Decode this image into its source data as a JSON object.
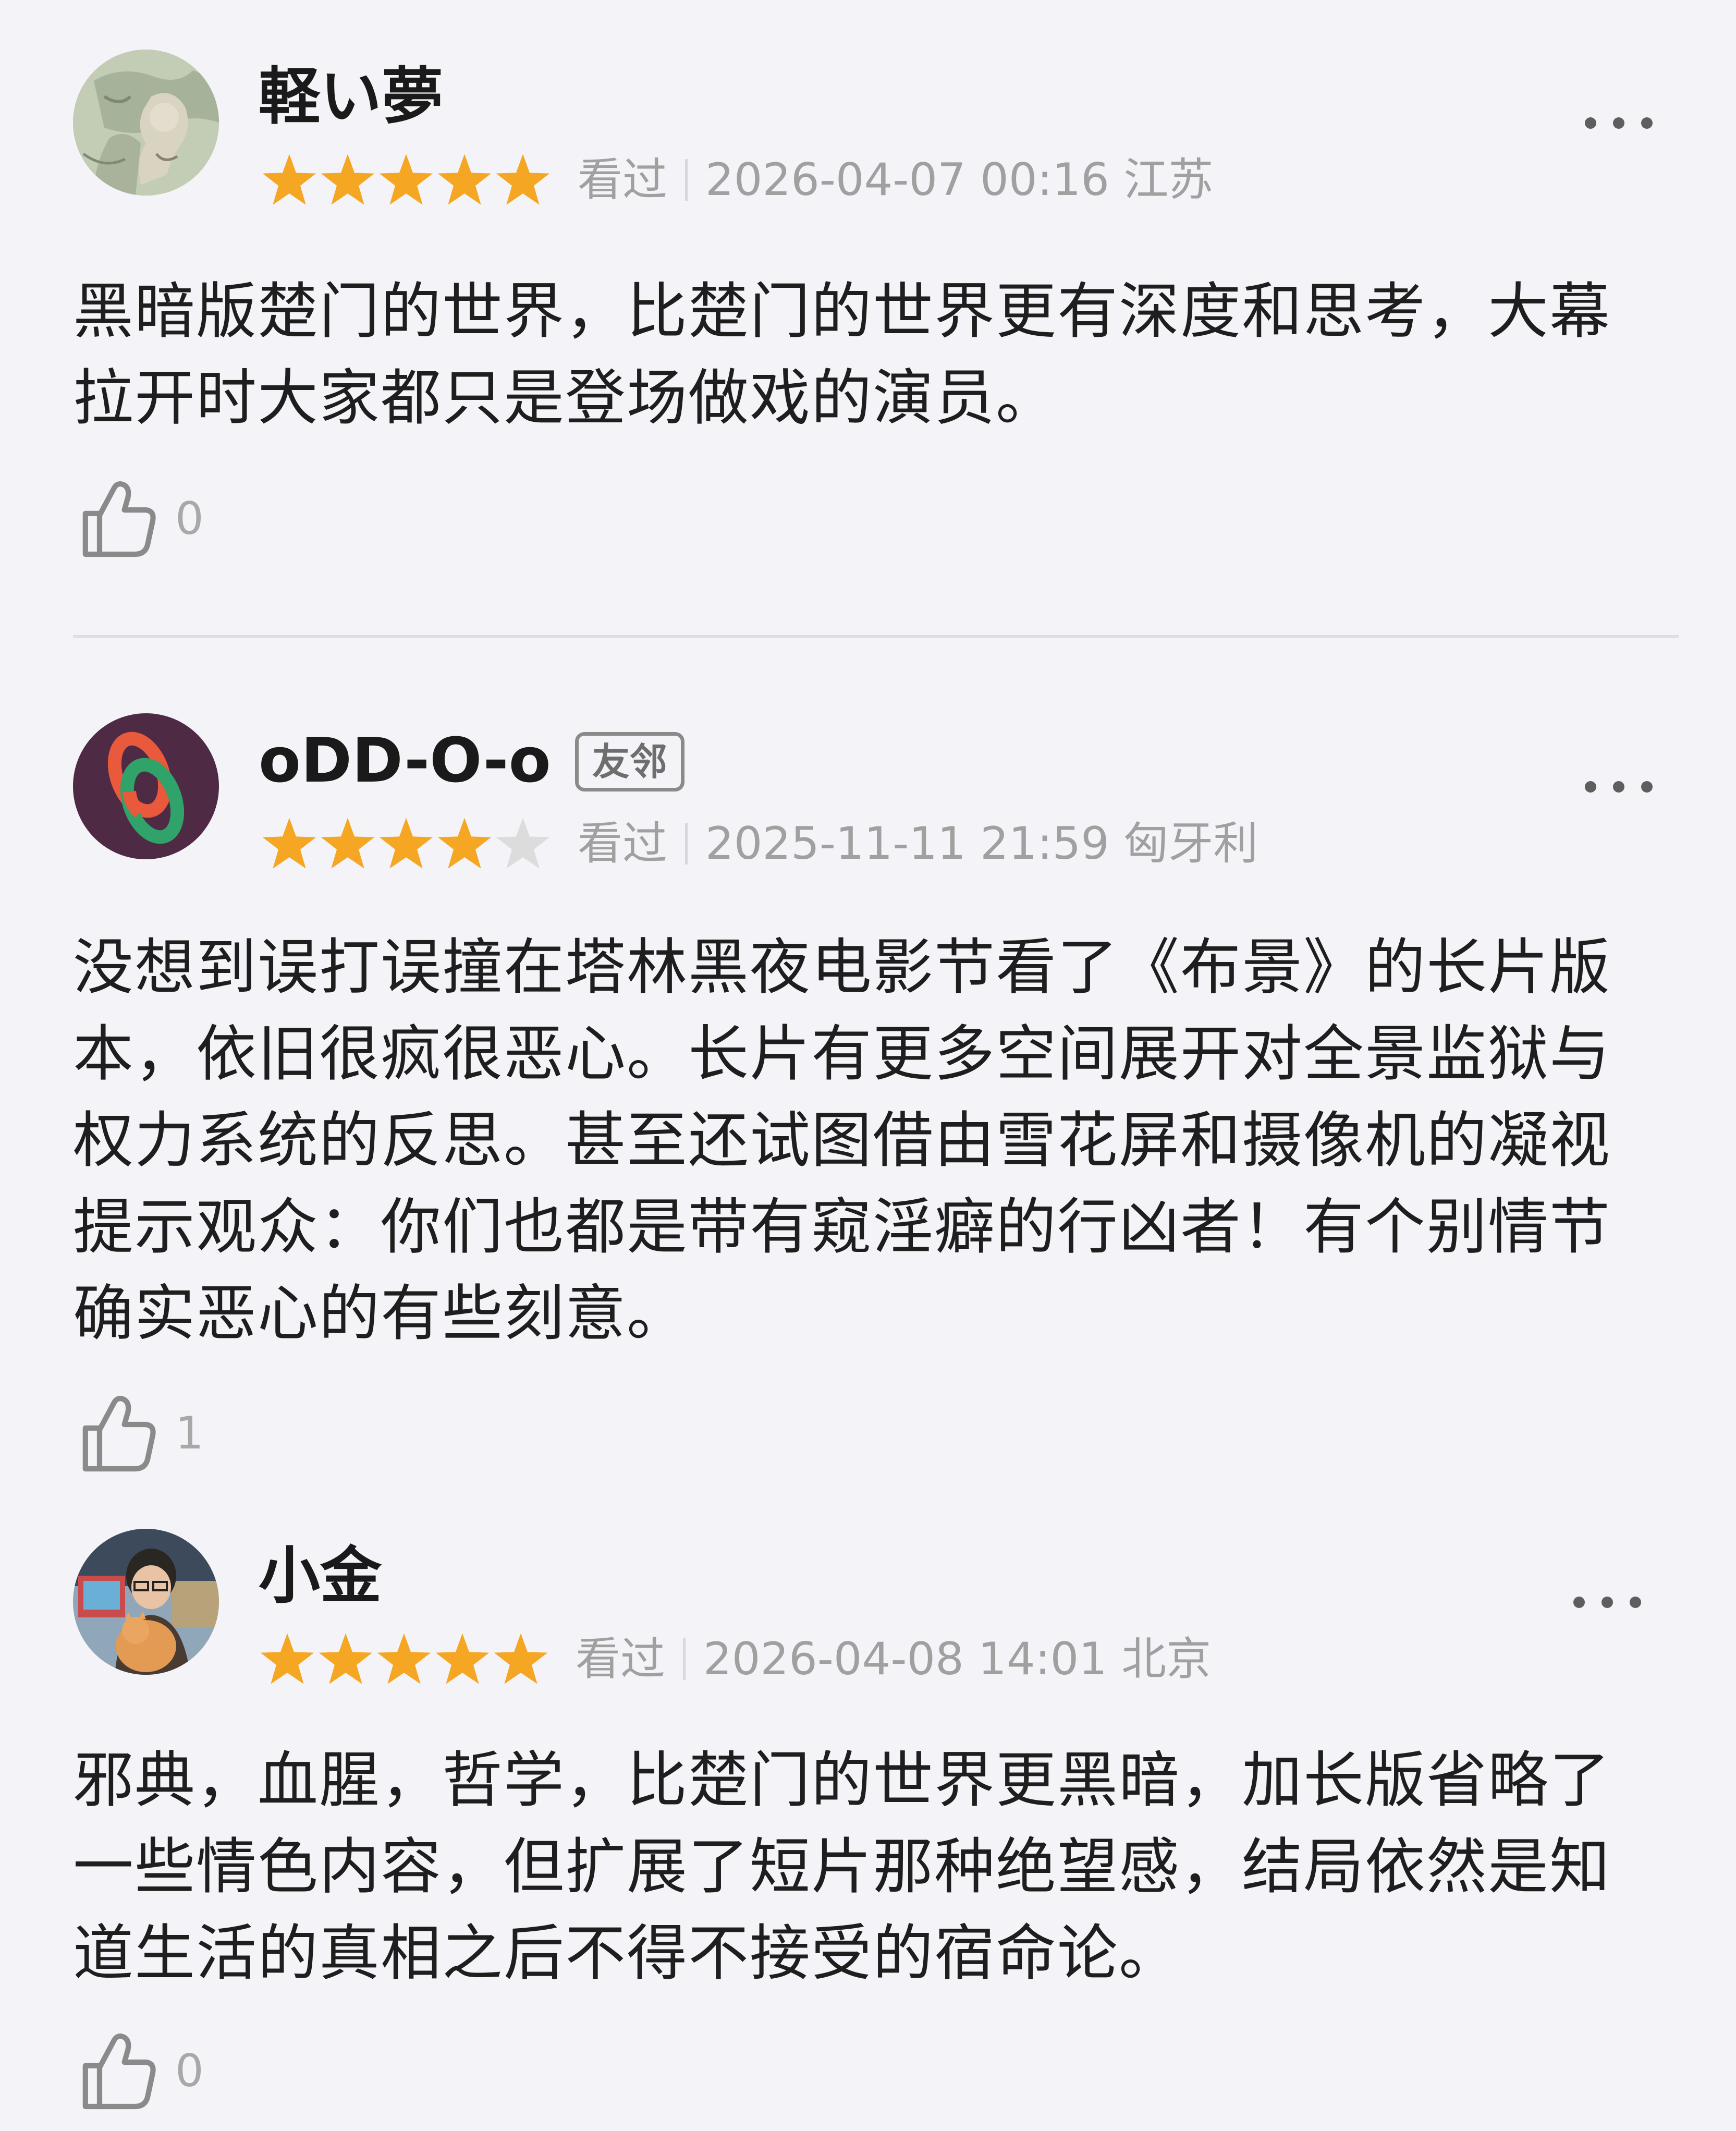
{
  "colors": {
    "background": "#f4f4f8",
    "star_filled": "#f5a623",
    "star_empty": "#dcdcdc",
    "meta_text": "#a0a0a0"
  },
  "reviews": [
    {
      "username": "軽い夢",
      "badge": "",
      "rating": 5,
      "status": "看过",
      "datetime": "2026-04-07 00:16 江苏",
      "text": "黑暗版楚门的世界，比楚门的世界更有深度和思考，大幕拉开时大家都只是登场做戏的演员。",
      "likes": "0",
      "avatar_icon": "sketch-avatar-icon",
      "more_icon": "more-dots-icon",
      "like_icon": "thumbs-up-icon"
    },
    {
      "username": "oDD-O-o",
      "badge": "友邻",
      "rating": 4,
      "status": "看过",
      "datetime": "2025-11-11 21:59 匈牙利",
      "text": "没想到误打误撞在塔林黑夜电影节看了《布景》的长片版本，依旧很疯很恶心。长片有更多空间展开对全景监狱与权力系统的反思。甚至还试图借由雪花屏和摄像机的凝视提示观众：你们也都是带有窥淫癖的行凶者！有个别情节确实恶心的有些刻意。",
      "likes": "1",
      "avatar_icon": "chain-link-avatar-icon",
      "more_icon": "more-dots-icon",
      "like_icon": "thumbs-up-icon"
    },
    {
      "username": "小金",
      "badge": "",
      "rating": 5,
      "status": "看过",
      "datetime": "2026-04-08 14:01 北京",
      "text": "邪典，血腥，哲学，比楚门的世界更黑暗，加长版省略了一些情色内容，但扩展了短片那种绝望感，结局依然是知道生活的真相之后不得不接受的宿命论。",
      "likes": "0",
      "avatar_icon": "person-with-cat-avatar-icon",
      "more_icon": "more-dots-icon",
      "like_icon": "thumbs-up-icon"
    }
  ]
}
